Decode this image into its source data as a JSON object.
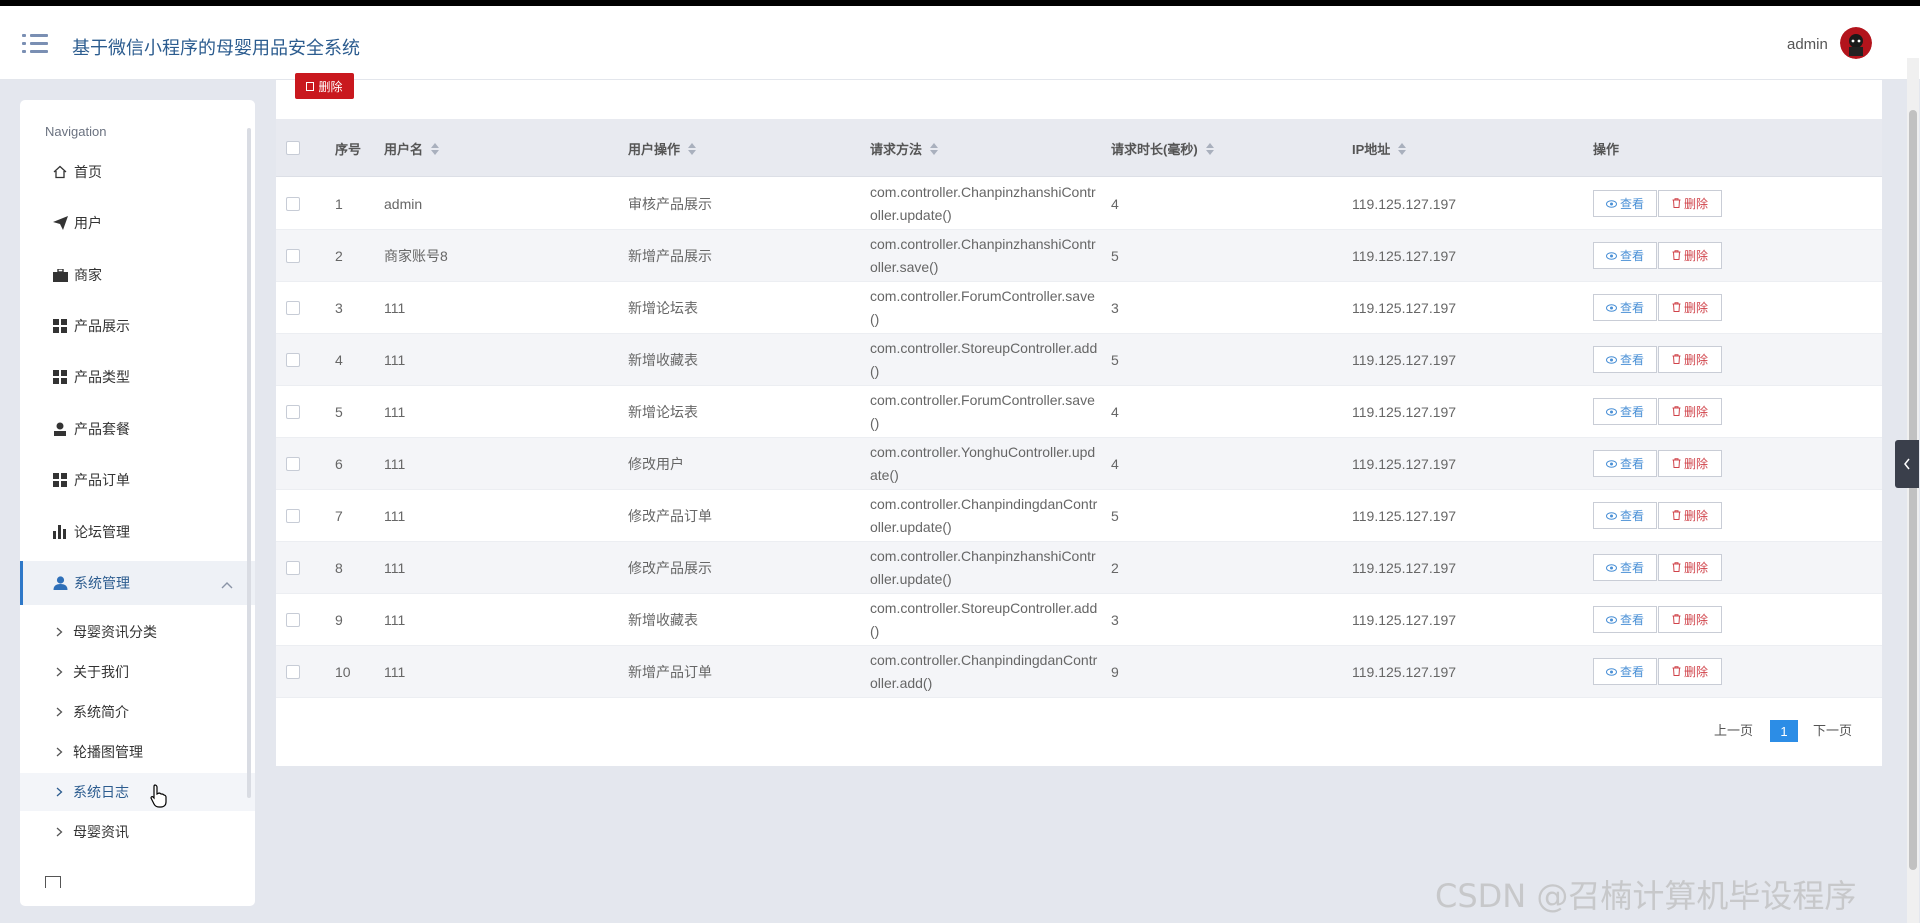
{
  "app": {
    "title": "基于微信小程序的母婴用品安全系统",
    "user": "admin"
  },
  "sidebar": {
    "title": "Navigation",
    "items": [
      {
        "label": "首页",
        "icon": "home-icon"
      },
      {
        "label": "用户",
        "icon": "paper-plane-icon"
      },
      {
        "label": "商家",
        "icon": "briefcase-icon"
      },
      {
        "label": "产品展示",
        "icon": "grid-icon"
      },
      {
        "label": "产品类型",
        "icon": "grid-icon"
      },
      {
        "label": "产品套餐",
        "icon": "user-icon"
      },
      {
        "label": "产品订单",
        "icon": "grid-icon"
      },
      {
        "label": "论坛管理",
        "icon": "bar-chart-icon"
      },
      {
        "label": "系统管理",
        "icon": "user-group-icon"
      }
    ],
    "sub_items": [
      "母婴资讯分类",
      "关于我们",
      "系统简介",
      "轮播图管理",
      "系统日志",
      "母婴资讯"
    ]
  },
  "toolbar": {
    "delete_label": "删除"
  },
  "table": {
    "headers": {
      "index": "序号",
      "username": "用户名",
      "operation": "用户操作",
      "method": "请求方法",
      "duration": "请求时长(毫秒)",
      "ip": "IP地址",
      "actions": "操作"
    },
    "view_label": "查看",
    "delete_label": "删除",
    "rows": [
      {
        "index": "1",
        "username": "admin",
        "operation": "审核产品展示",
        "method": "com.controller.ChanpinzhanshiController.update()",
        "duration": "4",
        "ip": "119.125.127.197"
      },
      {
        "index": "2",
        "username": "商家账号8",
        "operation": "新增产品展示",
        "method": "com.controller.ChanpinzhanshiController.save()",
        "duration": "5",
        "ip": "119.125.127.197"
      },
      {
        "index": "3",
        "username": "111",
        "operation": "新增论坛表",
        "method": "com.controller.ForumController.save()",
        "duration": "3",
        "ip": "119.125.127.197"
      },
      {
        "index": "4",
        "username": "111",
        "operation": "新增收藏表",
        "method": "com.controller.StoreupController.add()",
        "duration": "5",
        "ip": "119.125.127.197"
      },
      {
        "index": "5",
        "username": "111",
        "operation": "新增论坛表",
        "method": "com.controller.ForumController.save()",
        "duration": "4",
        "ip": "119.125.127.197"
      },
      {
        "index": "6",
        "username": "111",
        "operation": "修改用户",
        "method": "com.controller.YonghuController.update()",
        "duration": "4",
        "ip": "119.125.127.197"
      },
      {
        "index": "7",
        "username": "111",
        "operation": "修改产品订单",
        "method": "com.controller.ChanpindingdanController.update()",
        "duration": "5",
        "ip": "119.125.127.197"
      },
      {
        "index": "8",
        "username": "111",
        "operation": "修改产品展示",
        "method": "com.controller.ChanpinzhanshiController.update()",
        "duration": "2",
        "ip": "119.125.127.197"
      },
      {
        "index": "9",
        "username": "111",
        "operation": "新增收藏表",
        "method": "com.controller.StoreupController.add()",
        "duration": "3",
        "ip": "119.125.127.197"
      },
      {
        "index": "10",
        "username": "111",
        "operation": "新增产品订单",
        "method": "com.controller.ChanpindingdanController.add()",
        "duration": "9",
        "ip": "119.125.127.197"
      }
    ]
  },
  "pagination": {
    "prev": "上一页",
    "current": "1",
    "next": "下一页"
  },
  "watermark": "CSDN @召楠计算机毕设程序"
}
